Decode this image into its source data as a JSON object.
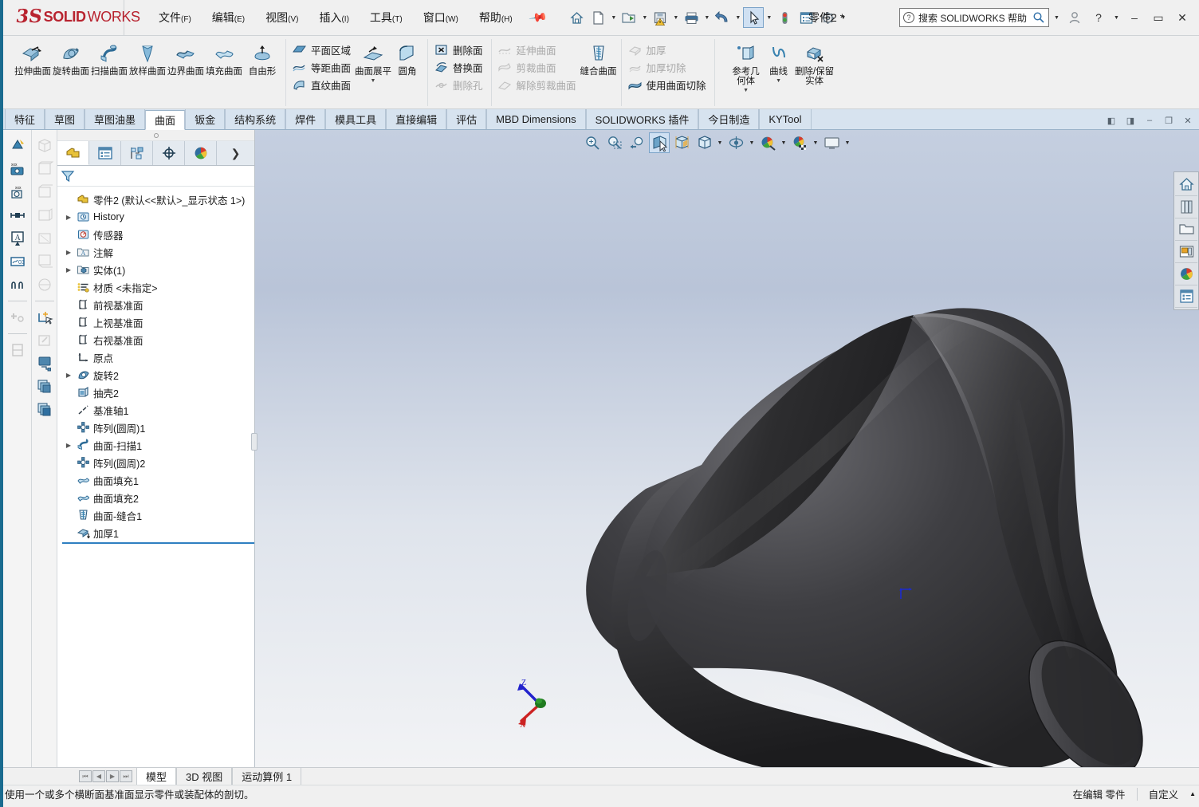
{
  "app": {
    "brand_mark": "3S",
    "brand_bold": "SOLID",
    "brand_light": "WORKS",
    "document_title": "零件2 *"
  },
  "menubar": {
    "items": [
      {
        "label": "文件",
        "mnemonic": "(F)"
      },
      {
        "label": "编辑",
        "mnemonic": "(E)"
      },
      {
        "label": "视图",
        "mnemonic": "(V)"
      },
      {
        "label": "插入",
        "mnemonic": "(I)"
      },
      {
        "label": "工具",
        "mnemonic": "(T)"
      },
      {
        "label": "窗口",
        "mnemonic": "(W)"
      },
      {
        "label": "帮助",
        "mnemonic": "(H)"
      }
    ],
    "pin_icon": "pushpin-icon"
  },
  "quick_access": {
    "buttons": [
      {
        "name": "home-button",
        "icon": "home-icon"
      },
      {
        "name": "new-document-button",
        "icon": "new-file-icon"
      },
      {
        "name": "open-document-button",
        "icon": "open-folder-icon"
      },
      {
        "name": "save-button",
        "icon": "save-warning-icon"
      },
      {
        "name": "print-button",
        "icon": "printer-icon"
      },
      {
        "name": "undo-button",
        "icon": "undo-arrow-icon"
      },
      {
        "name": "select-button",
        "icon": "cursor-arrow-icon"
      },
      {
        "name": "rebuild-button",
        "icon": "traffic-light-icon"
      },
      {
        "name": "options-list-button",
        "icon": "list-panel-icon"
      },
      {
        "name": "settings-button",
        "icon": "gear-icon"
      }
    ]
  },
  "search": {
    "placeholder": "搜索 SOLIDWORKS 帮助",
    "help_icon": "question-circle-icon",
    "magnifier_icon": "magnifier-icon"
  },
  "window_controls": {
    "profile": "user-account-icon",
    "help": "?",
    "minimize": "–",
    "maximize": "▭",
    "close": "✕"
  },
  "ribbon": {
    "groups": [
      {
        "name": "surface-create",
        "big_buttons": [
          {
            "label": "拉伸曲面",
            "icon": "extrude-surface-icon",
            "disabled": false
          },
          {
            "label": "旋转曲面",
            "icon": "revolve-surface-icon",
            "disabled": false
          },
          {
            "label": "扫描曲面",
            "icon": "sweep-surface-icon",
            "disabled": false
          },
          {
            "label": "放样曲面",
            "icon": "loft-surface-icon",
            "disabled": false
          },
          {
            "label": "边界曲面",
            "icon": "boundary-surface-icon",
            "disabled": false
          },
          {
            "label": "填充曲面",
            "icon": "fill-surface-icon",
            "disabled": false
          },
          {
            "label": "自由形",
            "icon": "freeform-icon",
            "disabled": false
          }
        ]
      },
      {
        "name": "planar-offset-ruled",
        "small_buttons": [
          {
            "label": "平面区域",
            "icon": "planar-surface-icon",
            "disabled": false
          },
          {
            "label": "等距曲面",
            "icon": "offset-surface-icon",
            "disabled": false
          },
          {
            "label": "直纹曲面",
            "icon": "ruled-surface-icon",
            "disabled": false
          }
        ],
        "big_buttons": [
          {
            "label": "曲面展平",
            "icon": "flatten-surface-icon",
            "disabled": false,
            "caret": true
          },
          {
            "label": "圆角",
            "icon": "fillet-icon",
            "disabled": false
          }
        ]
      },
      {
        "name": "face-edit",
        "small_buttons": [
          {
            "label": "删除面",
            "icon": "delete-face-icon",
            "disabled": false
          },
          {
            "label": "替换面",
            "icon": "replace-face-icon",
            "disabled": false
          },
          {
            "label": "删除孔",
            "icon": "delete-hole-icon",
            "disabled": true
          }
        ]
      },
      {
        "name": "surface-modify",
        "small_buttons": [
          {
            "label": "延伸曲面",
            "icon": "extend-surface-icon",
            "disabled": true
          },
          {
            "label": "剪裁曲面",
            "icon": "trim-surface-icon",
            "disabled": true
          },
          {
            "label": "解除剪裁曲面",
            "icon": "untrim-surface-icon",
            "disabled": true
          }
        ],
        "big_buttons": [
          {
            "label": "缝合曲面",
            "icon": "knit-surface-icon",
            "disabled": false
          }
        ]
      },
      {
        "name": "thicken-cut",
        "small_buttons": [
          {
            "label": "加厚",
            "icon": "thicken-icon",
            "disabled": true
          },
          {
            "label": "加厚切除",
            "icon": "thicken-cut-icon",
            "disabled": true
          },
          {
            "label": "使用曲面切除",
            "icon": "cut-with-surface-icon",
            "disabled": false
          }
        ]
      },
      {
        "name": "reference-geometry",
        "big_buttons": [
          {
            "label": "参考几何体",
            "icon": "reference-geometry-icon",
            "disabled": false,
            "caret": true
          },
          {
            "label": "曲线",
            "icon": "curves-icon",
            "disabled": false,
            "caret": true
          },
          {
            "label": "删除/保留实体",
            "icon": "delete-keep-body-icon",
            "disabled": false
          }
        ]
      }
    ]
  },
  "command_tabs": {
    "items": [
      {
        "label": "特征",
        "active": false
      },
      {
        "label": "草图",
        "active": false
      },
      {
        "label": "草图油墨",
        "active": false
      },
      {
        "label": "曲面",
        "active": true
      },
      {
        "label": "钣金",
        "active": false
      },
      {
        "label": "结构系统",
        "active": false
      },
      {
        "label": "焊件",
        "active": false
      },
      {
        "label": "模具工具",
        "active": false
      },
      {
        "label": "直接编辑",
        "active": false
      },
      {
        "label": "评估",
        "active": false
      },
      {
        "label": "MBD Dimensions",
        "active": false
      },
      {
        "label": "SOLIDWORKS 插件",
        "active": false
      },
      {
        "label": "今日制造",
        "active": false
      },
      {
        "label": "KYTool",
        "active": false
      }
    ],
    "window_buttons": [
      {
        "name": "restore-left-button",
        "glyph": "◧"
      },
      {
        "name": "restore-right-button",
        "glyph": "◨"
      },
      {
        "name": "doc-minimize-button",
        "glyph": "–"
      },
      {
        "name": "doc-restore-button",
        "glyph": "❐"
      },
      {
        "name": "doc-close-button",
        "glyph": "✕"
      }
    ]
  },
  "left_rail_1": {
    "icons": [
      "smart-dimension-icon",
      "dimxpert-size-icon",
      "dimxpert-location-icon",
      "datum-icon",
      "geometric-tolerance-icon",
      "surface-finish-icon",
      "hole-callout-icon",
      "auto-dimension-icon",
      "dimxpert-manager-icon"
    ]
  },
  "left_rail_2": {
    "icons": [
      "view-iso-icon",
      "view-front-icon",
      "view-top-icon",
      "view-right-icon",
      "view-back-icon",
      "view-bottom-icon",
      "view-left-icon",
      "new-view-icon",
      "edit-view-icon",
      "display-state-icon",
      "copy-view-icon",
      "paste-view-icon"
    ]
  },
  "feature_manager": {
    "tabs": [
      {
        "name": "feature-manager-tab",
        "icon": "part-tree-icon",
        "active": true
      },
      {
        "name": "property-manager-tab",
        "icon": "property-list-icon",
        "active": false
      },
      {
        "name": "configuration-manager-tab",
        "icon": "configuration-icon",
        "active": false
      },
      {
        "name": "dimxpert-manager-tab",
        "icon": "dimxpert-target-icon",
        "active": false
      },
      {
        "name": "display-manager-tab",
        "icon": "appearance-sphere-icon",
        "active": false
      }
    ],
    "more_glyph": "❯",
    "filter_icon": "filter-funnel-icon",
    "tree": [
      {
        "label": "零件2  (默认<<默认>_显示状态 1>)",
        "icon": "part-icon",
        "twist": false,
        "indent": 0,
        "root": true
      },
      {
        "label": "History",
        "icon": "history-icon",
        "twist": true,
        "indent": 1
      },
      {
        "label": "传感器",
        "icon": "sensors-icon",
        "twist": false,
        "indent": 1
      },
      {
        "label": "注解",
        "icon": "annotations-icon",
        "twist": true,
        "indent": 1
      },
      {
        "label": "实体(1)",
        "icon": "solid-bodies-icon",
        "twist": true,
        "indent": 1
      },
      {
        "label": "材质 <未指定>",
        "icon": "material-icon",
        "twist": false,
        "indent": 1
      },
      {
        "label": "前视基准面",
        "icon": "plane-icon",
        "twist": false,
        "indent": 1
      },
      {
        "label": "上视基准面",
        "icon": "plane-icon",
        "twist": false,
        "indent": 1
      },
      {
        "label": "右视基准面",
        "icon": "plane-icon",
        "twist": false,
        "indent": 1
      },
      {
        "label": "原点",
        "icon": "origin-icon",
        "twist": false,
        "indent": 1
      },
      {
        "label": "旋转2",
        "icon": "revolve-icon",
        "twist": true,
        "indent": 1
      },
      {
        "label": "抽壳2",
        "icon": "shell-icon",
        "twist": false,
        "indent": 1
      },
      {
        "label": "基准轴1",
        "icon": "axis-icon",
        "twist": false,
        "indent": 1
      },
      {
        "label": "阵列(圆周)1",
        "icon": "circular-pattern-icon",
        "twist": false,
        "indent": 1
      },
      {
        "label": "曲面-扫描1",
        "icon": "surface-sweep-icon",
        "twist": true,
        "indent": 1
      },
      {
        "label": "阵列(圆周)2",
        "icon": "circular-pattern-icon",
        "twist": false,
        "indent": 1
      },
      {
        "label": "曲面填充1",
        "icon": "surface-fill-icon",
        "twist": false,
        "indent": 1
      },
      {
        "label": "曲面填充2",
        "icon": "surface-fill-icon",
        "twist": false,
        "indent": 1
      },
      {
        "label": "曲面-缝合1",
        "icon": "surface-knit-icon",
        "twist": false,
        "indent": 1
      },
      {
        "label": "加厚1",
        "icon": "thicken-icon",
        "twist": false,
        "indent": 1
      }
    ]
  },
  "view_toolbar": {
    "buttons": [
      {
        "name": "zoom-to-fit-button",
        "icon": "zoom-fit-icon",
        "caret": false,
        "selected": false
      },
      {
        "name": "zoom-to-area-button",
        "icon": "zoom-area-icon",
        "caret": false,
        "selected": false
      },
      {
        "name": "previous-view-button",
        "icon": "previous-view-icon",
        "caret": false,
        "selected": false
      },
      {
        "name": "section-view-button",
        "icon": "section-view-icon",
        "caret": false,
        "selected": true
      },
      {
        "name": "view-orientation-button",
        "icon": "view-orientation-icon",
        "caret": false,
        "selected": false
      },
      {
        "name": "display-style-button",
        "icon": "display-style-icon",
        "caret": true,
        "selected": false
      },
      {
        "name": "hide-show-button",
        "icon": "hide-show-items-icon",
        "caret": true,
        "selected": false
      },
      {
        "name": "edit-appearance-button",
        "icon": "edit-appearance-icon",
        "caret": true,
        "selected": false
      },
      {
        "name": "apply-scene-button",
        "icon": "apply-scene-icon",
        "caret": false,
        "selected": false
      },
      {
        "name": "view-settings-button",
        "icon": "view-settings-icon",
        "caret": true,
        "selected": false
      },
      {
        "name": "display-monitor-button",
        "icon": "monitor-icon",
        "caret": true,
        "selected": false
      }
    ]
  },
  "task_pane": {
    "icons": [
      {
        "name": "task-pane-home",
        "icon": "solidworks-resources-icon"
      },
      {
        "name": "task-pane-design-library",
        "icon": "design-library-icon"
      },
      {
        "name": "task-pane-file-explorer",
        "icon": "file-explorer-icon"
      },
      {
        "name": "task-pane-view-palette",
        "icon": "view-palette-icon"
      },
      {
        "name": "task-pane-appearances",
        "icon": "appearances-scenes-icon"
      },
      {
        "name": "task-pane-custom-properties",
        "icon": "custom-properties-icon"
      }
    ]
  },
  "triad": {
    "z_label": "Z",
    "x_label": "X",
    "z_color": "#2222cc",
    "x_color": "#cc2222",
    "y_color": "#1f7a1f"
  },
  "bottom_tabs": {
    "nav_buttons": [
      "⏮",
      "◀",
      "▶",
      "⏭"
    ],
    "items": [
      {
        "label": "模型",
        "active": true
      },
      {
        "label": "3D 视图",
        "active": false
      },
      {
        "label": "运动算例 1",
        "active": false
      }
    ]
  },
  "status_bar": {
    "message": "使用一个或多个横断面基准面显示零件或装配体的剖切。",
    "edit_state": "在编辑  零件",
    "customize": "自定义",
    "caret": "▲"
  },
  "colors": {
    "brand_red": "#b8232f",
    "accent_blue": "#1a6b8f",
    "tab_active_bg": "#ffffff",
    "ribbon_bg": "#f0f0f0",
    "model_dark": "#3a3a3c",
    "gfx_top": "#c5cfe0",
    "gfx_bottom": "#f2f3f5"
  }
}
